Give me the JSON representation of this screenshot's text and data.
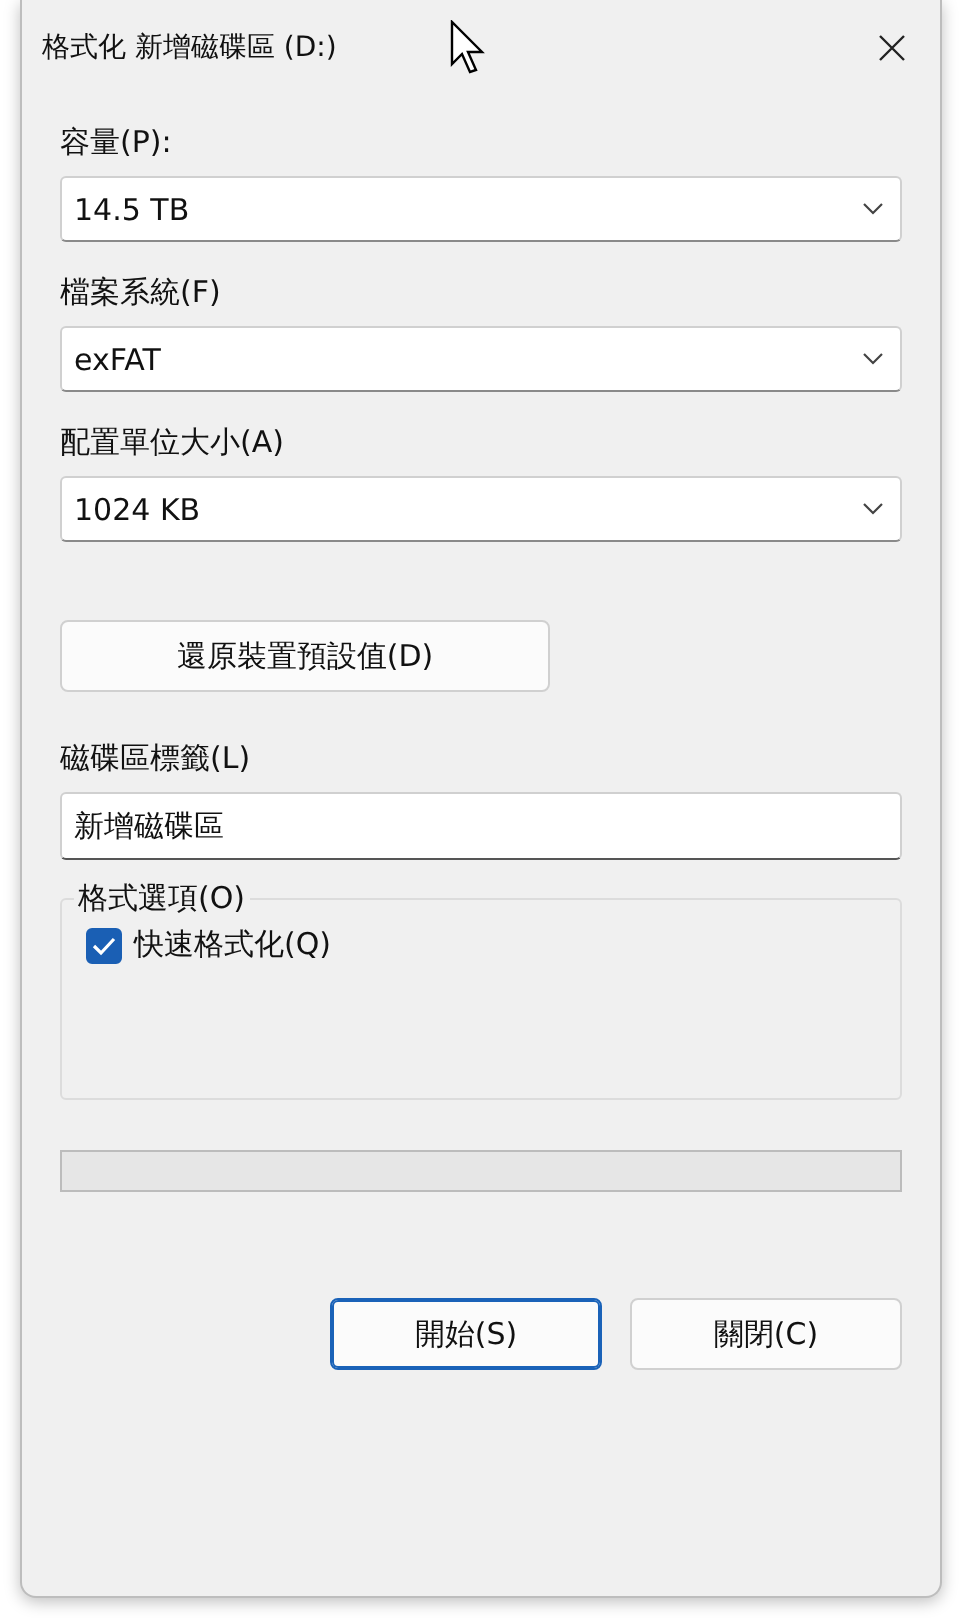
{
  "window": {
    "title": "格式化 新增磁碟區 (D:)"
  },
  "dropdowns": [
    {
      "label": "容量(P):",
      "value": "14.5 TB"
    },
    {
      "label": "檔案系統(F)",
      "value": "exFAT"
    },
    {
      "label": "配置單位大小(A)",
      "value": "1024 KB"
    }
  ],
  "restore_button": "還原裝置預設值(D)",
  "volume_label": {
    "label": "磁碟區標籤(L)",
    "value": "新增磁碟區"
  },
  "format_options": {
    "title": "格式選項(O)",
    "options": [
      {
        "label": "快速格式化(Q)",
        "checked": true
      }
    ]
  },
  "progress": {
    "level": 0
  },
  "buttons": [
    {
      "label": "開始(S)",
      "default": true
    },
    {
      "label": "關閉(C)",
      "default": false
    }
  ]
}
